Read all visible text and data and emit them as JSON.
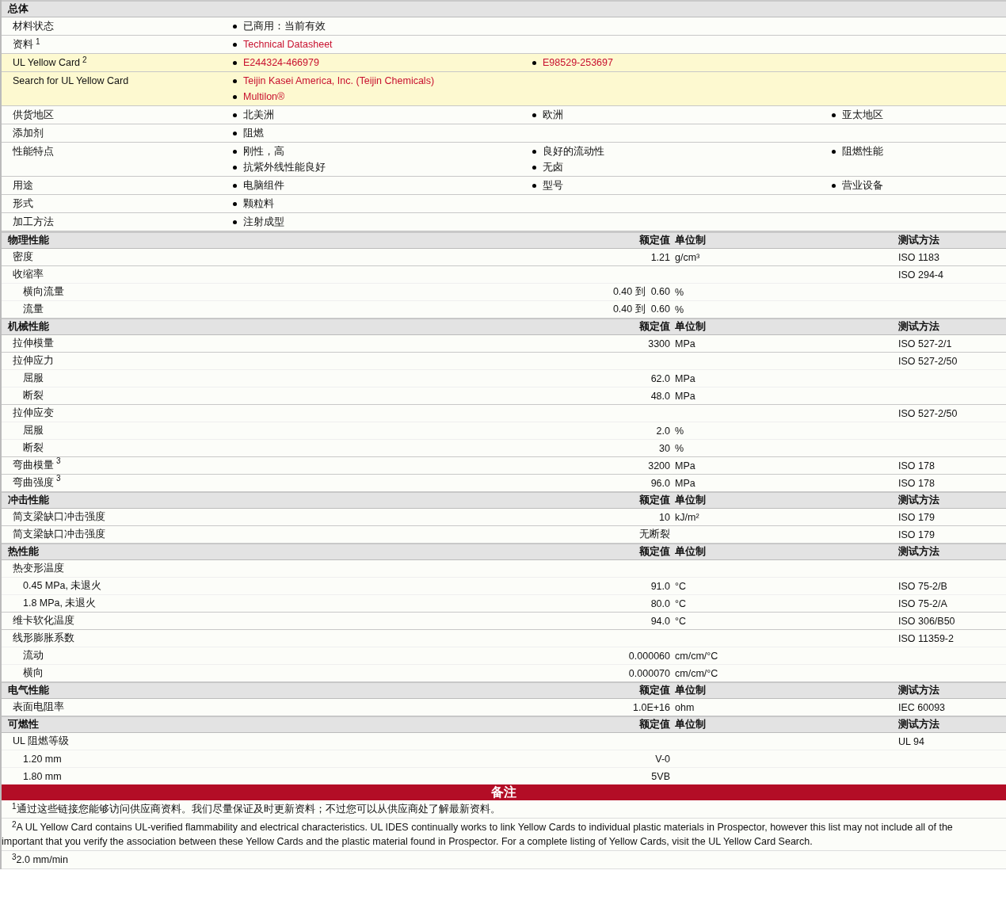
{
  "general": {
    "title": "总体",
    "rows": [
      {
        "label": "材料状态",
        "highlighted": false,
        "columns": [
          [
            {
              "text": "已商用：当前有效",
              "link": false
            }
          ]
        ]
      },
      {
        "label": "资料",
        "note": "1",
        "highlighted": false,
        "columns": [
          [
            {
              "text": "Technical Datasheet",
              "link": true
            }
          ]
        ]
      },
      {
        "label": "UL Yellow Card",
        "note": "2",
        "highlighted": true,
        "columns": [
          [
            {
              "text": "E244324-466979",
              "link": true
            }
          ],
          [
            {
              "text": "E98529-253697",
              "link": true
            }
          ]
        ]
      },
      {
        "label": "Search for UL Yellow Card",
        "highlighted": true,
        "columns": [
          [
            {
              "text": "Teijin Kasei America, Inc. (Teijin Chemicals)",
              "link": true
            },
            {
              "text": "Multilon®",
              "link": true
            }
          ]
        ]
      },
      {
        "label": "供货地区",
        "highlighted": false,
        "columns": [
          [
            {
              "text": "北美洲",
              "link": false
            }
          ],
          [
            {
              "text": "欧洲",
              "link": false
            }
          ],
          [
            {
              "text": "亚太地区",
              "link": false
            }
          ]
        ]
      },
      {
        "label": "添加剂",
        "highlighted": false,
        "columns": [
          [
            {
              "text": "阻燃",
              "link": false
            }
          ]
        ]
      },
      {
        "label": "性能特点",
        "highlighted": false,
        "columns": [
          [
            {
              "text": "刚性，高",
              "link": false
            },
            {
              "text": "抗紫外线性能良好",
              "link": false
            }
          ],
          [
            {
              "text": "良好的流动性",
              "link": false
            },
            {
              "text": "无卤",
              "link": false
            }
          ],
          [
            {
              "text": "阻燃性能",
              "link": false
            }
          ]
        ]
      },
      {
        "label": "用途",
        "highlighted": false,
        "columns": [
          [
            {
              "text": "电脑组件",
              "link": false
            }
          ],
          [
            {
              "text": "型号",
              "link": false
            }
          ],
          [
            {
              "text": "营业设备",
              "link": false
            }
          ]
        ]
      },
      {
        "label": "形式",
        "highlighted": false,
        "columns": [
          [
            {
              "text": "颗粒料",
              "link": false
            }
          ]
        ]
      },
      {
        "label": "加工方法",
        "highlighted": false,
        "columns": [
          [
            {
              "text": "注射成型",
              "link": false
            }
          ]
        ]
      }
    ]
  },
  "sections": [
    {
      "title": "物理性能",
      "headers": {
        "value": "额定值",
        "unit": "单位制",
        "method": "测试方法"
      },
      "rows": [
        {
          "label": "密度",
          "value": "1.21",
          "unit": "g/cm³",
          "method": "ISO 1183"
        },
        {
          "label": "收缩率",
          "method": "ISO 294-4",
          "children": [
            {
              "label": "横向流量",
              "value": "0.40 到  0.60",
              "unit": "%"
            },
            {
              "label": "流量",
              "value": "0.40 到  0.60",
              "unit": "%"
            }
          ]
        }
      ]
    },
    {
      "title": "机械性能",
      "headers": {
        "value": "额定值",
        "unit": "单位制",
        "method": "测试方法"
      },
      "rows": [
        {
          "label": "拉伸模量",
          "value": "3300",
          "unit": "MPa",
          "method": "ISO 527-2/1"
        },
        {
          "label": "拉伸应力",
          "method": "ISO 527-2/50",
          "children": [
            {
              "label": "屈服",
              "value": "62.0",
              "unit": "MPa"
            },
            {
              "label": "断裂",
              "value": "48.0",
              "unit": "MPa"
            }
          ]
        },
        {
          "label": "拉伸应变",
          "method": "ISO 527-2/50",
          "children": [
            {
              "label": "屈服",
              "value": "2.0",
              "unit": "%"
            },
            {
              "label": "断裂",
              "value": "30",
              "unit": "%"
            }
          ]
        },
        {
          "label": "弯曲模量",
          "note": "3",
          "value": "3200",
          "unit": "MPa",
          "method": "ISO 178"
        },
        {
          "label": "弯曲强度",
          "note": "3",
          "value": "96.0",
          "unit": "MPa",
          "method": "ISO 178"
        }
      ]
    },
    {
      "title": "冲击性能",
      "headers": {
        "value": "额定值",
        "unit": "单位制",
        "method": "测试方法"
      },
      "rows": [
        {
          "label": "简支梁缺口冲击强度",
          "value": "10",
          "unit": "kJ/m²",
          "method": "ISO 179"
        },
        {
          "label": "简支梁缺口冲击强度",
          "value": "无断裂",
          "method": "ISO 179"
        }
      ]
    },
    {
      "title": "热性能",
      "headers": {
        "value": "额定值",
        "unit": "单位制",
        "method": "测试方法"
      },
      "rows": [
        {
          "label": "热变形温度",
          "children": [
            {
              "label": "0.45 MPa, 未退火",
              "value": "91.0",
              "unit": "°C",
              "method": "ISO 75-2/B"
            },
            {
              "label": "1.8 MPa, 未退火",
              "value": "80.0",
              "unit": "°C",
              "method": "ISO 75-2/A"
            }
          ]
        },
        {
          "label": "维卡软化温度",
          "value": "94.0",
          "unit": "°C",
          "method": "ISO 306/B50"
        },
        {
          "label": "线形膨胀系数",
          "method": "ISO 11359-2",
          "children": [
            {
              "label": "流动",
              "value": "0.000060",
              "unit": "cm/cm/°C"
            },
            {
              "label": "横向",
              "value": "0.000070",
              "unit": "cm/cm/°C"
            }
          ]
        }
      ]
    },
    {
      "title": "电气性能",
      "headers": {
        "value": "额定值",
        "unit": "单位制",
        "method": "测试方法"
      },
      "rows": [
        {
          "label": "表面电阻率",
          "value": "1.0E+16",
          "unit": "ohm",
          "method": "IEC 60093"
        }
      ]
    },
    {
      "title": "可燃性",
      "headers": {
        "value": "额定值",
        "unit": "单位制",
        "method": "测试方法"
      },
      "rows": [
        {
          "label": "UL 阻燃等级",
          "method": "UL 94",
          "children": [
            {
              "label": "1.20 mm",
              "value": "V-0"
            },
            {
              "label": "1.80 mm",
              "value": "5VB"
            }
          ]
        }
      ]
    }
  ],
  "notes": {
    "title": "备注",
    "items": [
      {
        "mark": "1",
        "lines": [
          "通过这些链接您能够访问供应商资料。我们尽量保证及时更新资料；不过您可以从供应商处了解最新资料。"
        ]
      },
      {
        "mark": "2",
        "lines": [
          "A UL Yellow Card contains UL-verified flammability and electrical characteristics. UL IDES continually works to link Yellow Cards to individual plastic materials in Prospector, however this list may not include all of the",
          "important that you verify the association between these Yellow Cards and the plastic material found in Prospector. For a complete listing of Yellow Cards, visit the UL Yellow Card Search."
        ]
      },
      {
        "mark": "3",
        "lines": [
          "2.0 mm/min"
        ]
      }
    ]
  }
}
